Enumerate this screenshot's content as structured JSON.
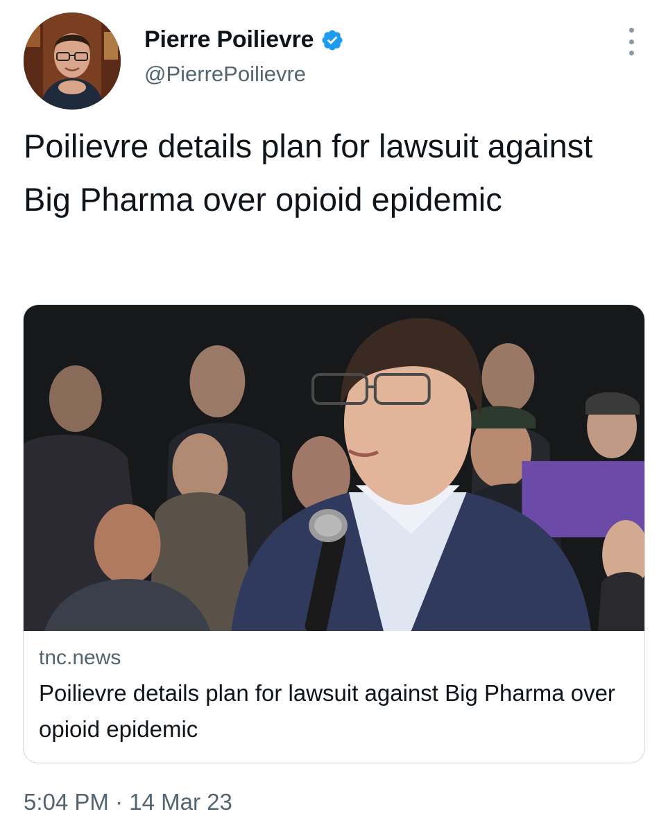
{
  "author": {
    "name": "Pierre Poilievre",
    "handle": "@PierrePoilievre",
    "verified": true
  },
  "tweet": {
    "text": "Poilievre details plan for lawsuit against Big Pharma over opioid epidemic"
  },
  "link_card": {
    "domain": "tnc.news",
    "title": "Poilievre details plan for lawsuit against Big Pharma over opioid epidemic"
  },
  "timestamp": {
    "time": "5:04 PM",
    "separator": "·",
    "date": "14 Mar 23"
  },
  "colors": {
    "verified_blue": "#1d9bf0",
    "secondary_text": "#536471",
    "primary_text": "#0f1419"
  },
  "icons": {
    "verified": "verified-badge-icon",
    "more": "more-options-icon"
  }
}
